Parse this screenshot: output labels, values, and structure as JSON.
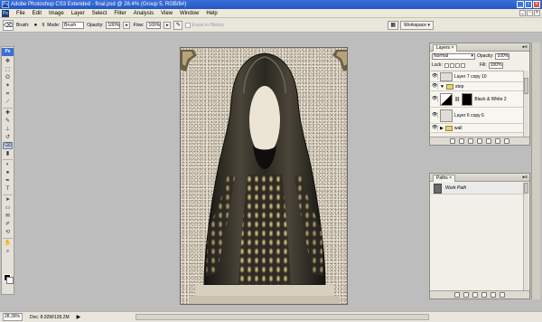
{
  "window": {
    "title": "Adobe Photoshop CS3 Extended - final.psd @ 28.4% (Group 5, RGB/8#)",
    "app_icon": "Ps",
    "buttons": [
      "_",
      "▫",
      "×"
    ]
  },
  "menubar": {
    "logo": "Ps",
    "items": [
      "File",
      "Edit",
      "Image",
      "Layer",
      "Select",
      "Filter",
      "Analysis",
      "View",
      "Window",
      "Help"
    ],
    "doc_buttons": [
      "_",
      "▫",
      "×"
    ]
  },
  "options_bar": {
    "brush_label": "Brush:",
    "brush_size": "9",
    "mode_label": "Mode:",
    "mode_value": "Brush",
    "opacity_label": "Opacity:",
    "opacity_value": "100%",
    "flow_label": "Flow:",
    "flow_value": "100%",
    "erase_to_history": "Erase to History",
    "workspace_label": "Workspace ▾"
  },
  "toolbox": {
    "badge": "Ps",
    "tools": [
      {
        "name": "move-tool",
        "glyph": "✥"
      },
      {
        "name": "marquee-tool",
        "glyph": "⬚"
      },
      {
        "name": "lasso-tool",
        "glyph": "ʘ"
      },
      {
        "name": "magic-wand-tool",
        "glyph": "✶"
      },
      {
        "name": "crop-tool",
        "glyph": "⌗"
      },
      {
        "name": "slice-tool",
        "glyph": "⟋"
      },
      {
        "name": "healing-brush-tool",
        "glyph": "✚"
      },
      {
        "name": "brush-tool",
        "glyph": "✎"
      },
      {
        "name": "clone-stamp-tool",
        "glyph": "⊥"
      },
      {
        "name": "history-brush-tool",
        "glyph": "↺"
      },
      {
        "name": "eraser-tool",
        "glyph": "⌫"
      },
      {
        "name": "gradient-tool",
        "glyph": "▮"
      },
      {
        "name": "blur-tool",
        "glyph": "◐"
      },
      {
        "name": "dodge-tool",
        "glyph": "●"
      },
      {
        "name": "pen-tool",
        "glyph": "✒"
      },
      {
        "name": "type-tool",
        "glyph": "T"
      },
      {
        "name": "path-selection-tool",
        "glyph": "➤"
      },
      {
        "name": "shape-tool",
        "glyph": "▭"
      },
      {
        "name": "notes-tool",
        "glyph": "✉"
      },
      {
        "name": "eyedropper-tool",
        "glyph": "✐"
      },
      {
        "name": "3d-rotate-tool",
        "glyph": "⟲"
      },
      {
        "name": "hand-tool",
        "glyph": "✋"
      },
      {
        "name": "zoom-tool",
        "glyph": "⌕"
      }
    ],
    "active_tool_index": 10,
    "foreground_color": "#000000",
    "background_color": "#ffffff"
  },
  "status_bar": {
    "zoom": "28.39%",
    "doc_size": "Doc: 8.92M/139.2M",
    "arrow": "▶"
  },
  "layers_panel": {
    "tab": "Layers ×",
    "menu": "▸≡",
    "blend_mode": "Normal",
    "opacity_label": "Opacity:",
    "opacity_value": "100%",
    "lock_label": "Lock:",
    "fill_label": "Fill:",
    "fill_value": "100%",
    "layers": [
      {
        "name": "Layer 7 copy 10",
        "kind": "layer",
        "visible": true
      },
      {
        "name": "step",
        "kind": "group",
        "visible": true
      },
      {
        "name": "Black & White 2",
        "kind": "adjustment",
        "visible": true
      },
      {
        "name": "Layer 6 copy 6",
        "kind": "layer",
        "visible": true
      },
      {
        "name": "wall",
        "kind": "group",
        "visible": true
      }
    ]
  },
  "paths_panel": {
    "tab": "Paths ×",
    "menu": "▸≡",
    "paths": [
      {
        "name": "Work Path"
      }
    ]
  },
  "colors": {
    "titlebar": "#2457c6",
    "menubar": "#ece9d8",
    "workspace_bg": "#bdbdbd",
    "cloak_dark": "#2a2822",
    "cloak_highlight": "#b49a62"
  }
}
